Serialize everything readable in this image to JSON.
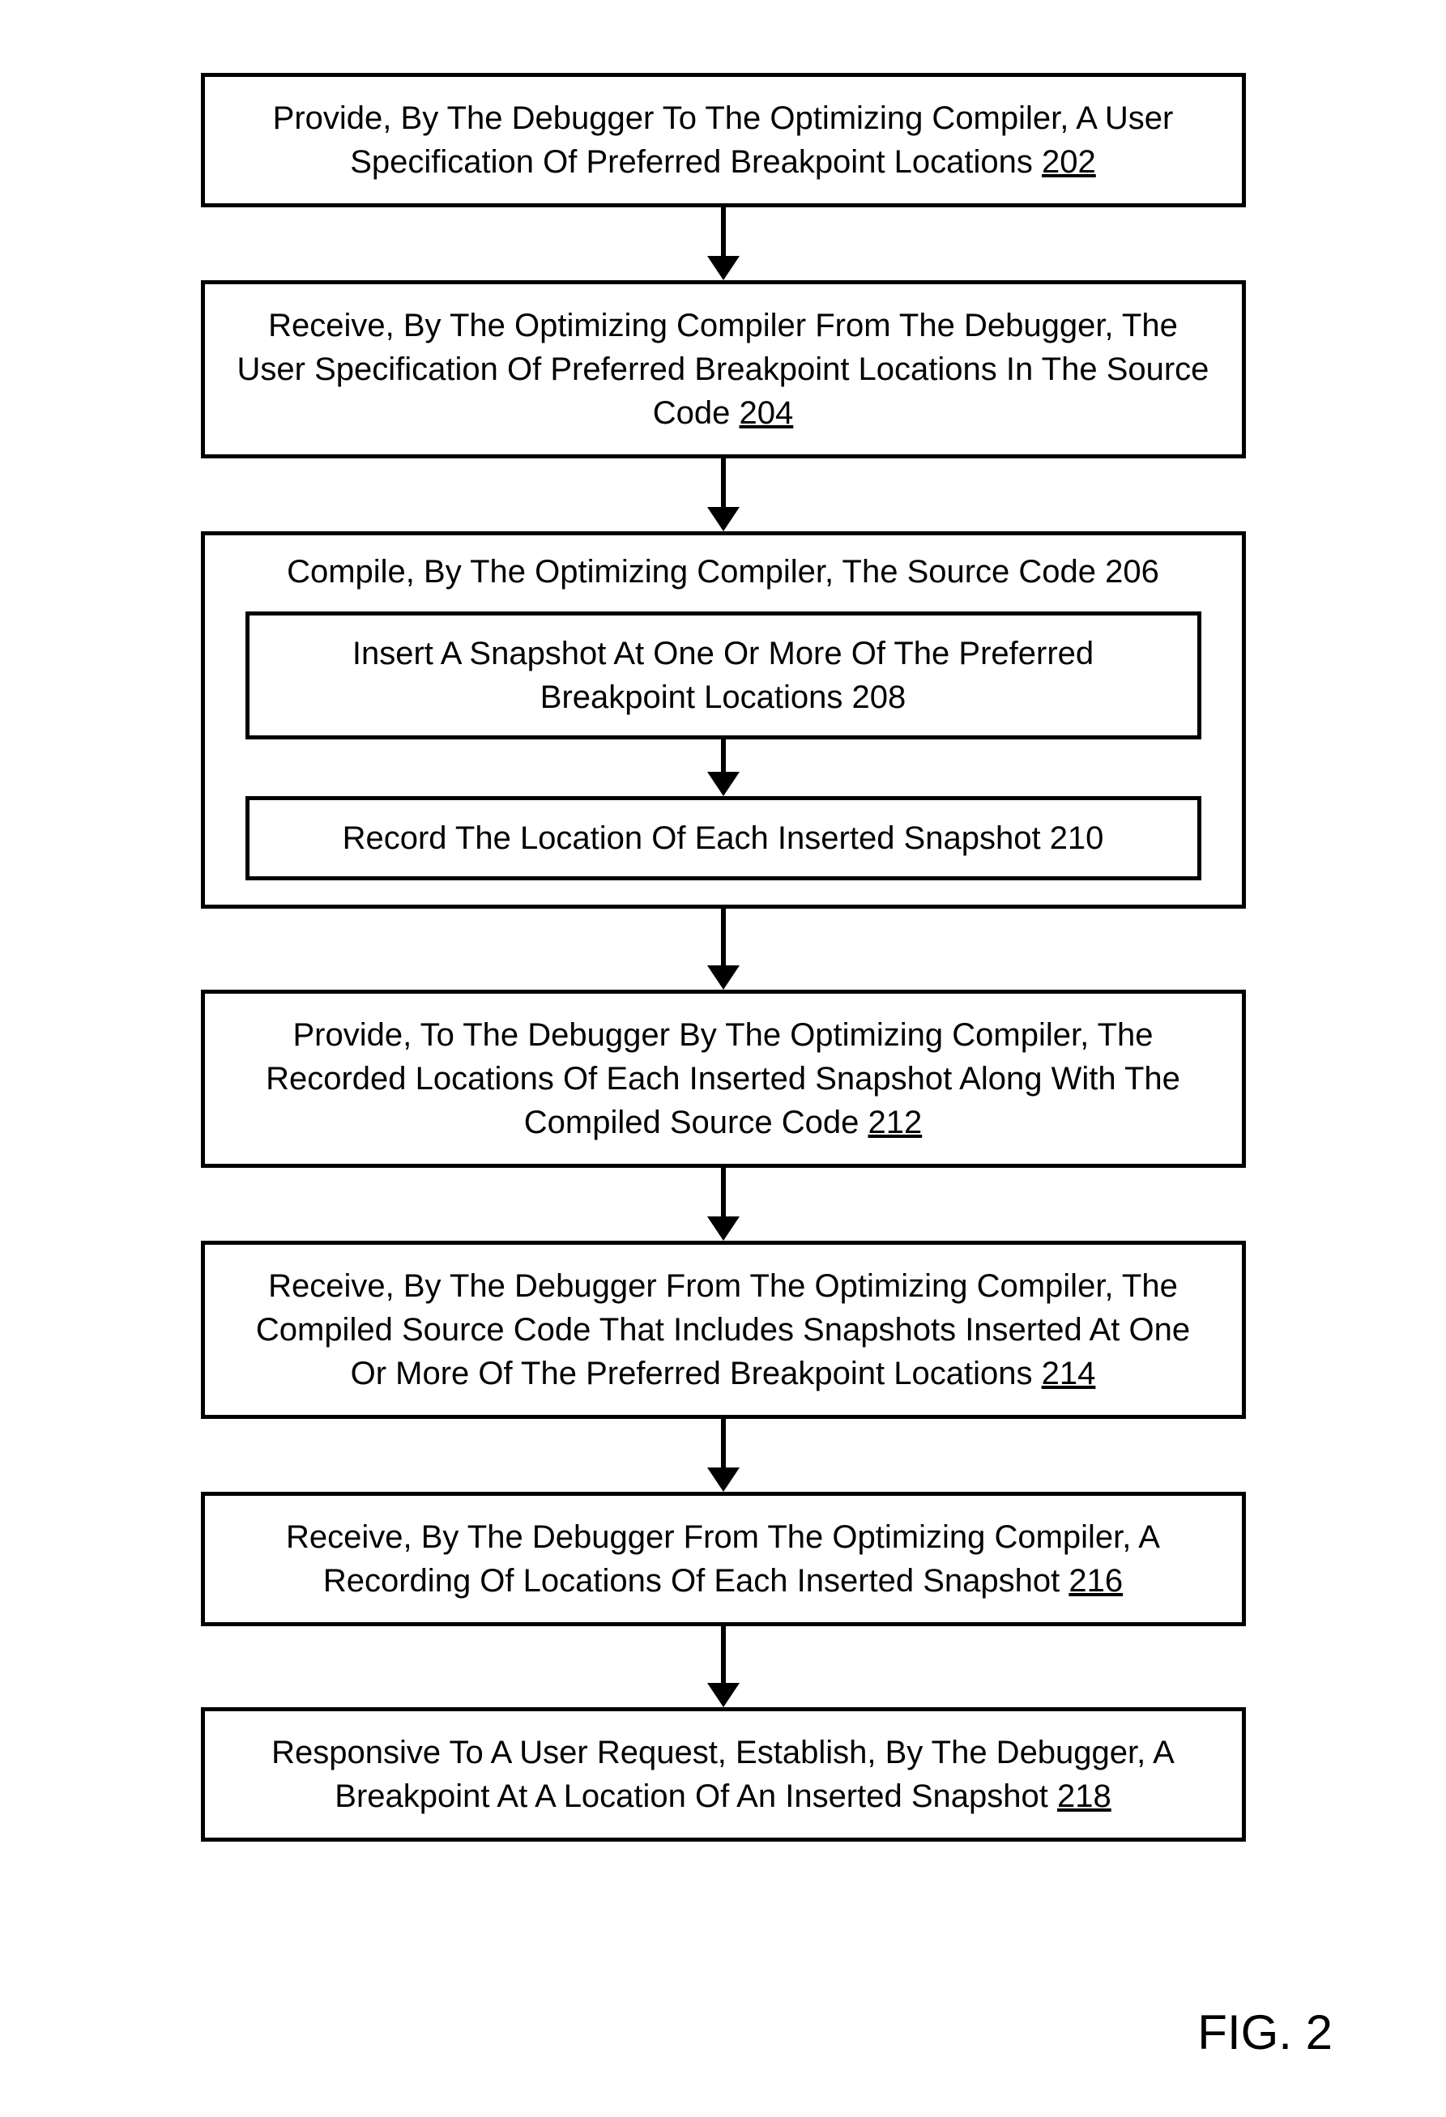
{
  "steps": {
    "s202": {
      "text": "Provide, By The Debugger To The Optimizing Compiler, A User Specification Of Preferred Breakpoint Locations ",
      "ref": "202"
    },
    "s204": {
      "text": "Receive, By The Optimizing Compiler From The Debugger, The User Specification Of Preferred Breakpoint Locations In The Source Code ",
      "ref": "204"
    },
    "s206": {
      "text": "Compile, By The Optimizing Compiler, The Source Code ",
      "ref": "206"
    },
    "s208": {
      "text": "Insert A Snapshot At One Or More Of The Preferred Breakpoint Locations ",
      "ref": "208"
    },
    "s210": {
      "text": "Record The Location Of Each Inserted Snapshot ",
      "ref": "210"
    },
    "s212": {
      "text": "Provide, To The Debugger By The Optimizing Compiler, The Recorded Locations Of Each Inserted Snapshot Along With The Compiled Source Code ",
      "ref": "212"
    },
    "s214": {
      "text": "Receive, By The Debugger From The Optimizing Compiler, The Compiled Source Code That Includes Snapshots Inserted At One Or More Of The Preferred Breakpoint Locations ",
      "ref": "214"
    },
    "s216": {
      "text": "Receive, By The Debugger From The Optimizing Compiler, A Recording Of Locations Of Each Inserted Snapshot ",
      "ref": "216"
    },
    "s218": {
      "text": "Responsive To A User Request, Establish, By The Debugger, A Breakpoint At A Location Of An Inserted Snapshot ",
      "ref": "218"
    }
  },
  "figure_label": "FIG. 2"
}
